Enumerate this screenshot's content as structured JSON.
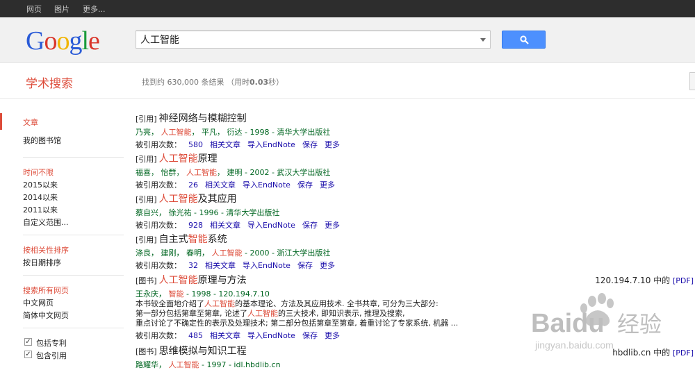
{
  "topbar": {
    "items": [
      "网页",
      "图片",
      "更多..."
    ]
  },
  "logo": {
    "letters": [
      "G",
      "o",
      "o",
      "g",
      "l",
      "e"
    ],
    "colors": [
      "#2a5bd7",
      "#d9362b",
      "#f1b400",
      "#2a5bd7",
      "#1a9b3a",
      "#d9362b"
    ]
  },
  "search": {
    "value": "人工智能"
  },
  "subheader": {
    "title": "学术搜索",
    "stats_prefix": "找到约 630,000 条结果 （用时",
    "stats_time": "0.03",
    "stats_suffix": "秒）"
  },
  "sidebar": {
    "doc_types": [
      "文章",
      "我的图书馆"
    ],
    "time": [
      "时间不限",
      "2015以来",
      "2014以来",
      "2011以来",
      "自定义范围..."
    ],
    "sort": [
      "按相关性排序",
      "按日期排序"
    ],
    "lang": [
      "搜索所有网页",
      "中文网页",
      "简体中文网页"
    ],
    "checks": [
      "包括专利",
      "包含引用"
    ]
  },
  "results": [
    {
      "tag": "[引用]",
      "t1": "神经网络与模糊控制",
      "t2": "",
      "t3": "",
      "m1": "乃亮， ",
      "m2": "人工智能",
      "m3": "， 平凡， 衍达 - 1998 - 清华大学出版社",
      "cited": "被引用次数：",
      "cited_n": "580",
      "links": [
        "相关文章",
        "导入EndNote",
        "保存",
        "更多"
      ]
    },
    {
      "tag": "[引用]",
      "t1": "",
      "t2": "人工智能",
      "t3": "原理",
      "m1": "福喜， 怡群， ",
      "m2": "人工智能",
      "m3": "， 建明 - 2002 - 武汉大学出版社",
      "cited": "被引用次数：",
      "cited_n": "26",
      "links": [
        "相关文章",
        "导入EndNote",
        "保存",
        "更多"
      ]
    },
    {
      "tag": "[引用]",
      "t1": "",
      "t2": "人工智能",
      "t3": "及其应用",
      "m1": "蔡自兴， 徐光祐 - 1996 - 清华大学出版社",
      "m2": "",
      "m3": "",
      "cited": "被引用次数：",
      "cited_n": "928",
      "links": [
        "相关文章",
        "导入EndNote",
        "保存",
        "更多"
      ]
    },
    {
      "tag": "[引用]",
      "t1": "自主式",
      "t2": "智能",
      "t3": "系统",
      "m1": "涤良， 建刚， 春明， ",
      "m2": "人工智能",
      "m3": " - 2000 - 浙江大学出版社",
      "cited": "被引用次数：",
      "cited_n": "32",
      "links": [
        "相关文章",
        "导入EndNote",
        "保存",
        "更多"
      ]
    },
    {
      "tag": "[图书]",
      "t1": "",
      "t2": "人工智能",
      "t3": "原理与方法",
      "m1": "王永庆， ",
      "m2": "智能",
      "m3": " - 1998 - 120.194.7.10",
      "snip1a": "本书较全面地介绍了",
      "snip1b": "人工智能",
      "snip1c": "的基本理论、方法及其应用技术. 全书共章, 可分为三大部分:",
      "snip2a": "第一部分包括第章至第章, 论述了",
      "snip2b": "人工智能",
      "snip2c": "的三大技术, 即知识表示, 推理及搜索,",
      "snip3": "重点讨论了不确定性的表示及处理技术; 第二部分包括第章至第章, 着重讨论了专家系统, 机器 ...",
      "cited": "被引用次数：",
      "cited_n": "485",
      "links": [
        "相关文章",
        "导入EndNote",
        "保存",
        "更多"
      ],
      "pdf_host": "120.194.7.10 中的",
      "pdf_tag": "[PDF]"
    },
    {
      "tag": "[图书]",
      "t1": "思维模拟与知识工程",
      "t2": "",
      "t3": "",
      "m1": "路耀华， ",
      "m2": "人工智能",
      "m3": " - 1997 - idl.hbdlib.cn",
      "pdf_host": "hbdlib.cn 中的",
      "pdf_tag": "[PDF]"
    }
  ],
  "watermark": {
    "brand": "Baidu",
    "cn": "经验",
    "url": "jingyan.baidu.com"
  }
}
